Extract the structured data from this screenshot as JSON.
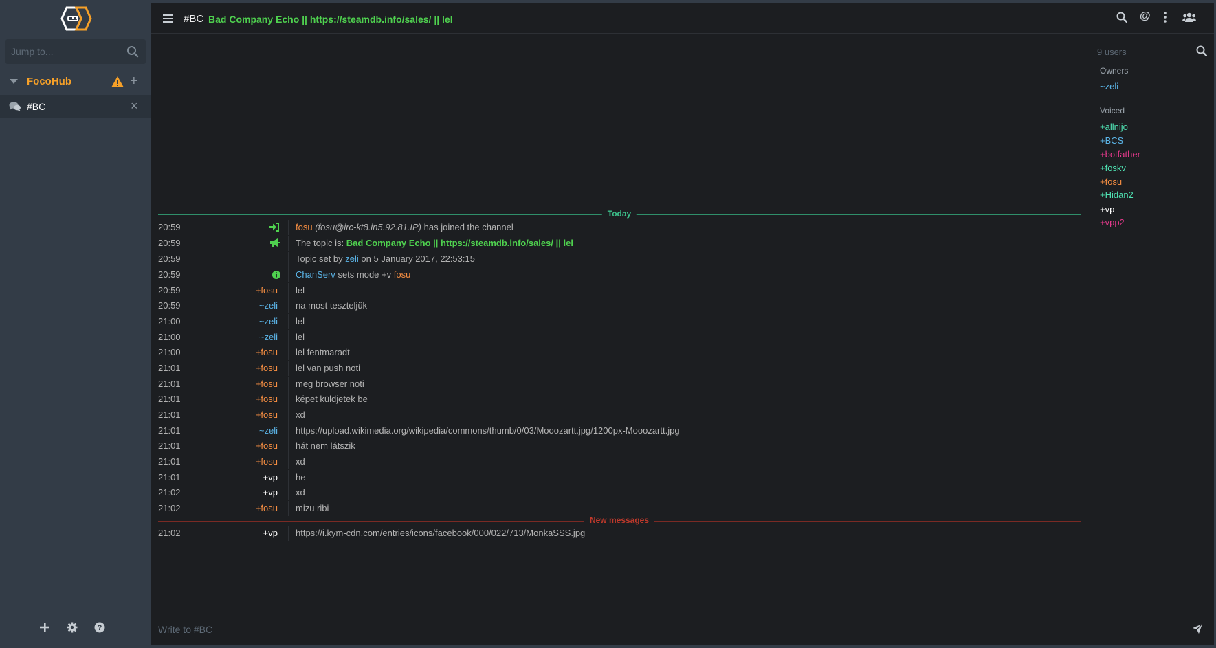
{
  "sidebar": {
    "search_placeholder": "Jump to...",
    "network": "FocoHub",
    "channel": "#BC"
  },
  "header": {
    "channel": "#BC",
    "topic": "Bad Company Echo || https://steamdb.info/sales/ || lel"
  },
  "dividers": {
    "today": "Today",
    "new_messages": "New messages"
  },
  "messages": [
    {
      "time": "20:59",
      "type": "join",
      "nick": "fosu",
      "host": "(fosu@irc-kt8.in5.92.81.IP)",
      "text": "has joined the channel"
    },
    {
      "time": "20:59",
      "type": "topic",
      "prefix": "The topic is:",
      "topic": "Bad Company Echo || https://steamdb.info/sales/ || lel"
    },
    {
      "time": "20:59",
      "type": "topic_set",
      "p1": "Topic set by",
      "nick": "zeli",
      "p2": "on 5 January 2017, 22:53:15"
    },
    {
      "time": "20:59",
      "type": "mode",
      "nick": "ChanServ",
      "mid": "sets mode +v",
      "target": "fosu"
    },
    {
      "time": "20:59",
      "from": "+fosu",
      "text": "lel"
    },
    {
      "time": "20:59",
      "from": "~zeli",
      "text": "na most teszteljük"
    },
    {
      "time": "21:00",
      "from": "~zeli",
      "text": "lel"
    },
    {
      "time": "21:00",
      "from": "~zeli",
      "text": "lel"
    },
    {
      "time": "21:00",
      "from": "+fosu",
      "text": "lel fentmaradt"
    },
    {
      "time": "21:01",
      "from": "+fosu",
      "text": "lel van push noti"
    },
    {
      "time": "21:01",
      "from": "+fosu",
      "text": "meg browser noti"
    },
    {
      "time": "21:01",
      "from": "+fosu",
      "text": "képet küldjetek be"
    },
    {
      "time": "21:01",
      "from": "+fosu",
      "text": "xd"
    },
    {
      "time": "21:01",
      "from": "~zeli",
      "text": "https://upload.wikimedia.org/wikipedia/commons/thumb/0/03/Mooozartt.jpg/1200px-Mooozartt.jpg"
    },
    {
      "time": "21:01",
      "from": "+fosu",
      "text": "hát nem látszik"
    },
    {
      "time": "21:01",
      "from": "+fosu",
      "text": "xd"
    },
    {
      "time": "21:01",
      "from": "+vp",
      "text": "he"
    },
    {
      "time": "21:02",
      "from": "+vp",
      "text": "xd"
    },
    {
      "time": "21:02",
      "from": "+fosu",
      "text": "mizu ribi"
    },
    {
      "time": "21:02",
      "from": "+vp",
      "text": "https://i.kym-cdn.com/entries/icons/facebook/000/022/713/MonkaSSS.jpg"
    }
  ],
  "userlist": {
    "search_placeholder": "9 users",
    "owners_title": "Owners",
    "owners": [
      "~zeli"
    ],
    "voiced_title": "Voiced",
    "voiced": [
      "+allnijo",
      "+BCS",
      "+botfather",
      "+foskv",
      "+fosu",
      "+Hidan2",
      "+vp",
      "+vpp2"
    ]
  },
  "composer": {
    "placeholder": "Write to #BC"
  },
  "colors": {
    "accent": "#f6a028",
    "topic_green": "#4fd14f",
    "link_green": "#57b657",
    "nick_orange": "#f68e42",
    "nick_blue": "#5bb5e8",
    "nick_pink": "#e3398b",
    "nick_teal": "#4fe3b3",
    "new_messages_red": "#c0392b"
  },
  "icons": [
    "logo-icon",
    "search-icon",
    "warning-icon",
    "plus-icon",
    "chat-icon",
    "close-icon",
    "settings-icon",
    "help-icon",
    "menu-icon",
    "mention-icon",
    "more-icon",
    "users-icon",
    "join-icon",
    "topic-icon",
    "info-icon",
    "send-icon"
  ]
}
